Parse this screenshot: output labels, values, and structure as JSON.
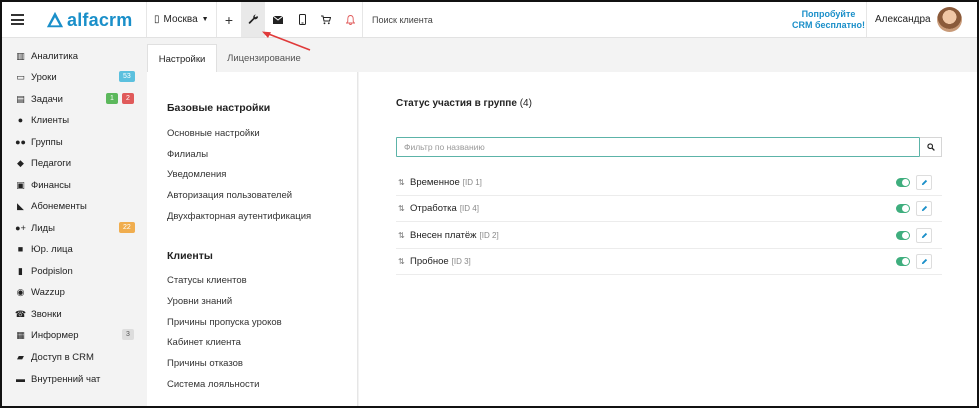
{
  "topbar": {
    "logo_text": "alfacrm",
    "city": "Москва",
    "search_placeholder": "Поиск клиента",
    "promo_line1": "Попробуйте",
    "promo_line2": "CRM бесплатно!",
    "user_name": "Александра"
  },
  "sidebar": {
    "items": [
      {
        "label": "Аналитика",
        "icon": "map-icon"
      },
      {
        "label": "Уроки",
        "icon": "calendar-icon",
        "badges": [
          "53"
        ]
      },
      {
        "label": "Задачи",
        "icon": "clipboard-icon",
        "badges": [
          "1",
          "2"
        ]
      },
      {
        "label": "Клиенты",
        "icon": "user-icon"
      },
      {
        "label": "Группы",
        "icon": "users-icon"
      },
      {
        "label": "Педагоги",
        "icon": "graduation-cap-icon"
      },
      {
        "label": "Финансы",
        "icon": "money-icon"
      },
      {
        "label": "Абонементы",
        "icon": "tag-icon"
      },
      {
        "label": "Лиды",
        "icon": "user-plus-icon",
        "badges": [
          "22"
        ]
      },
      {
        "label": "Юр. лица",
        "icon": "briefcase-icon"
      },
      {
        "label": "Podpislon",
        "icon": "file-icon"
      },
      {
        "label": "Wazzup",
        "icon": "whatsapp-icon"
      },
      {
        "label": "Звонки",
        "icon": "phone-icon"
      },
      {
        "label": "Информер",
        "icon": "newspaper-icon",
        "badges": [
          "3"
        ]
      },
      {
        "label": "Доступ в CRM",
        "icon": "lock-icon"
      },
      {
        "label": "Внутренний чат",
        "icon": "chat-icon"
      }
    ]
  },
  "tabs": [
    {
      "label": "Настройки"
    },
    {
      "label": "Лицензирование"
    }
  ],
  "settings_menu": {
    "base_title": "Базовые настройки",
    "base_links": [
      "Основные настройки",
      "Филиалы",
      "Уведомления",
      "Авторизация пользователей",
      "Двухфакторная аутентификация"
    ],
    "clients_title": "Клиенты",
    "clients_links": [
      "Статусы клиентов",
      "Уровни знаний",
      "Причины пропуска уроков",
      "Кабинет клиента",
      "Причины отказов",
      "Система лояльности"
    ]
  },
  "group_status": {
    "title": "Статус участия в группе",
    "count": "(4)",
    "filter_placeholder": "Фильтр по названию",
    "rows": [
      {
        "name": "Временное",
        "id": "[ID 1]",
        "enabled": true
      },
      {
        "name": "Отработка",
        "id": "[ID 4]",
        "enabled": true
      },
      {
        "name": "Внесен платёж",
        "id": "[ID 2]",
        "enabled": true
      },
      {
        "name": "Пробное",
        "id": "[ID 3]",
        "enabled": true
      }
    ]
  },
  "colors": {
    "brand": "#1a8fc9",
    "toggle_on": "#3fae7e",
    "annotation_arrow": "#e03a3a"
  }
}
